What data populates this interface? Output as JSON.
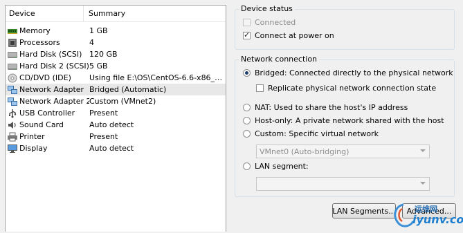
{
  "device_list": {
    "columns": {
      "device": "Device",
      "summary": "Summary"
    },
    "rows": [
      {
        "icon": "memory-icon",
        "device": "Memory",
        "summary": "1 GB"
      },
      {
        "icon": "processor-icon",
        "device": "Processors",
        "summary": "4"
      },
      {
        "icon": "hard-disk-icon",
        "device": "Hard Disk (SCSI)",
        "summary": "120 GB"
      },
      {
        "icon": "hard-disk-icon",
        "device": "Hard Disk 2 (SCSI)",
        "summary": "5 GB"
      },
      {
        "icon": "cd-dvd-icon",
        "device": "CD/DVD (IDE)",
        "summary": "Using file E:\\OS\\CentOS-6.6-x86_64..."
      },
      {
        "icon": "network-adapter-icon",
        "device": "Network Adapter",
        "summary": "Bridged (Automatic)",
        "selected": true
      },
      {
        "icon": "network-adapter-icon",
        "device": "Network Adapter 2",
        "summary": "Custom (VMnet2)"
      },
      {
        "icon": "usb-icon",
        "device": "USB Controller",
        "summary": "Present"
      },
      {
        "icon": "sound-card-icon",
        "device": "Sound Card",
        "summary": "Auto detect"
      },
      {
        "icon": "printer-icon",
        "device": "Printer",
        "summary": "Present"
      },
      {
        "icon": "display-icon",
        "device": "Display",
        "summary": "Auto detect"
      }
    ]
  },
  "device_status": {
    "title": "Device status",
    "connected": {
      "label": "Connected",
      "checked": false,
      "disabled": true
    },
    "connect_at_power_on": {
      "label": "Connect at power on",
      "checked": true
    }
  },
  "network_connection": {
    "title": "Network connection",
    "bridged": {
      "label": "Bridged: Connected directly to the physical network",
      "selected": true
    },
    "replicate": {
      "label": "Replicate physical network connection state",
      "checked": false
    },
    "nat": {
      "label": "NAT: Used to share the host's IP address",
      "selected": false
    },
    "host_only": {
      "label": "Host-only: A private network shared with the host",
      "selected": false
    },
    "custom": {
      "label": "Custom: Specific virtual network",
      "selected": false
    },
    "custom_select": {
      "value": "VMnet0 (Auto-bridging)"
    },
    "lan_segment": {
      "label": "LAN segment:",
      "selected": false
    },
    "lan_select": {
      "value": ""
    }
  },
  "buttons": {
    "lan_segments": "LAN Segments...",
    "advanced": "Advanced..."
  },
  "watermark": {
    "cn": "运维网",
    "url": "iyunv.com"
  },
  "colors": {
    "radio_dot": "#1d3f6e",
    "selected_row": "#e8e8e8",
    "group_border": "#d5dfe5"
  }
}
